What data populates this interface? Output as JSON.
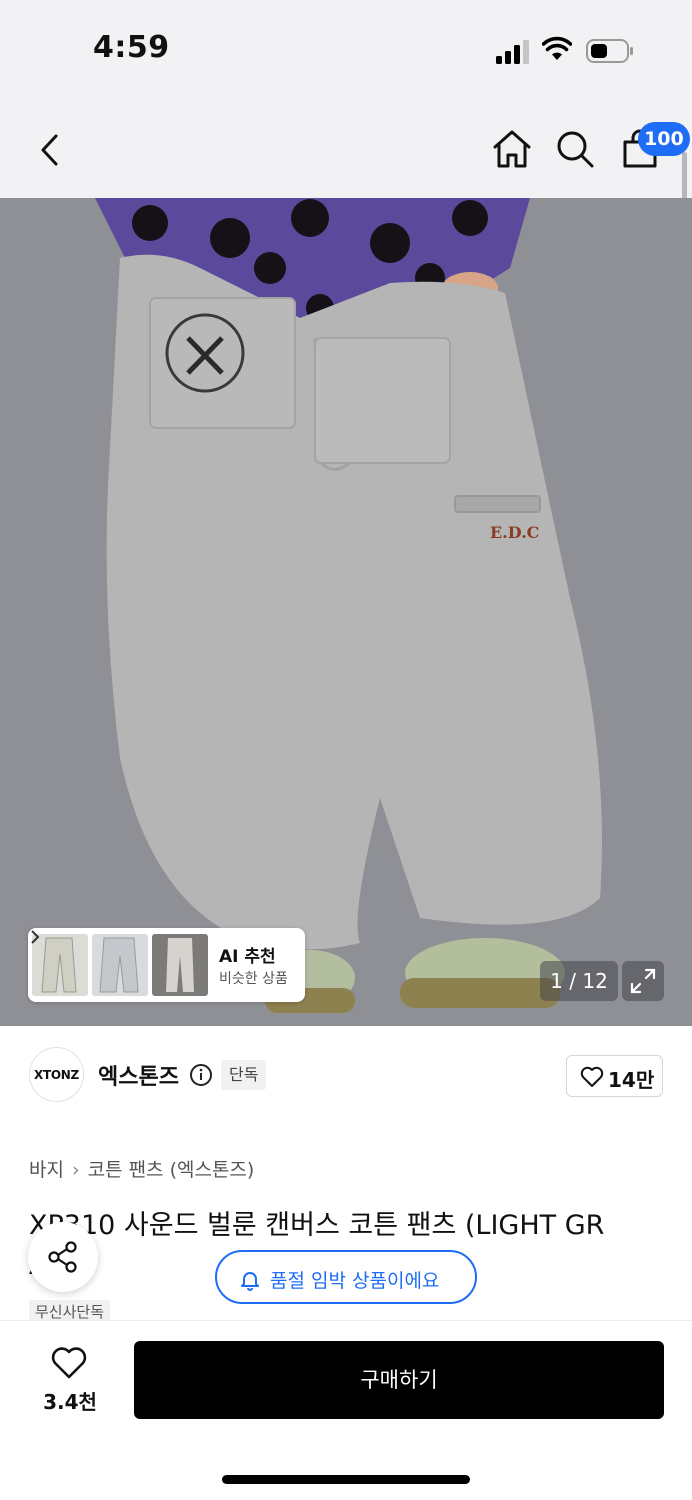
{
  "status_bar": {
    "time": "4:59"
  },
  "nav": {
    "cart_badge": "100"
  },
  "hero": {
    "ai_card": {
      "title": "AI 추천",
      "subtitle": "비슷한 상품"
    },
    "counter": "1 / 12"
  },
  "brand": {
    "logo_text": "XTONZ",
    "name": "엑스톤즈",
    "tag": "단독",
    "like_count": "14만"
  },
  "breadcrumb": {
    "category": "바지",
    "sub": "코튼 팬츠 (엑스톤즈)"
  },
  "product": {
    "title": "XP310 사운드 벌룬 캔버스 코튼 팬츠 (LIGHT GR",
    "title_line2": "A",
    "tag": "무신사단독"
  },
  "quality_notice": "품절 임박 상품이에요",
  "bottom": {
    "wish_count": "3.4천",
    "buy_label": "구매하기"
  },
  "colors": {
    "accent": "#1d6df5",
    "buy_button": "#000000",
    "badge": "#1d6df5"
  }
}
